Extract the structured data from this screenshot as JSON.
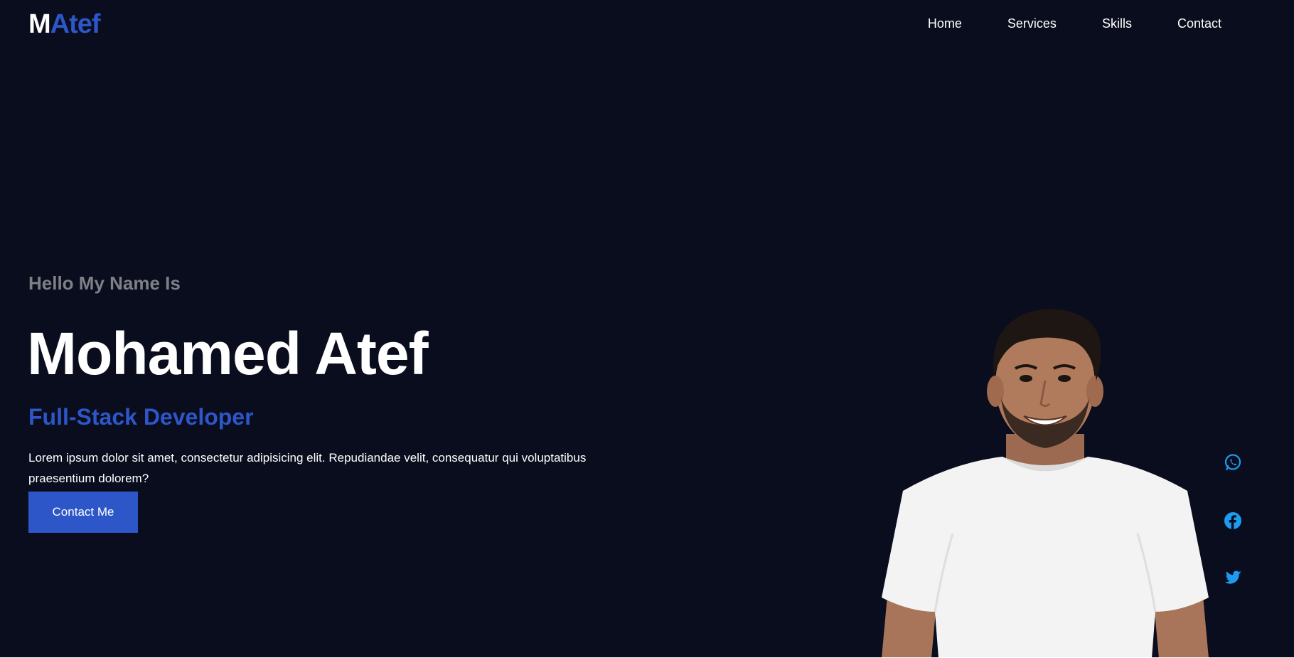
{
  "header": {
    "logo_first": "M",
    "logo_rest": "Atef",
    "nav": [
      {
        "label": "Home"
      },
      {
        "label": "Services"
      },
      {
        "label": "Skills"
      },
      {
        "label": "Contact"
      }
    ]
  },
  "hero": {
    "greeting": "Hello My Name Is",
    "name": "Mohamed Atef",
    "role": "Full-Stack Developer",
    "description": "Lorem ipsum dolor sit amet, consectetur adipisicing elit. Repudiandae velit, consequatur qui voluptatibus praesentium dolorem?",
    "cta_label": "Contact Me"
  },
  "social": [
    {
      "icon": "whatsapp-icon"
    },
    {
      "icon": "facebook-icon"
    },
    {
      "icon": "twitter-icon"
    }
  ],
  "colors": {
    "background": "#090d1d",
    "accent": "#2d56c9",
    "muted": "#7f8086",
    "social": "#1d9bf0"
  }
}
